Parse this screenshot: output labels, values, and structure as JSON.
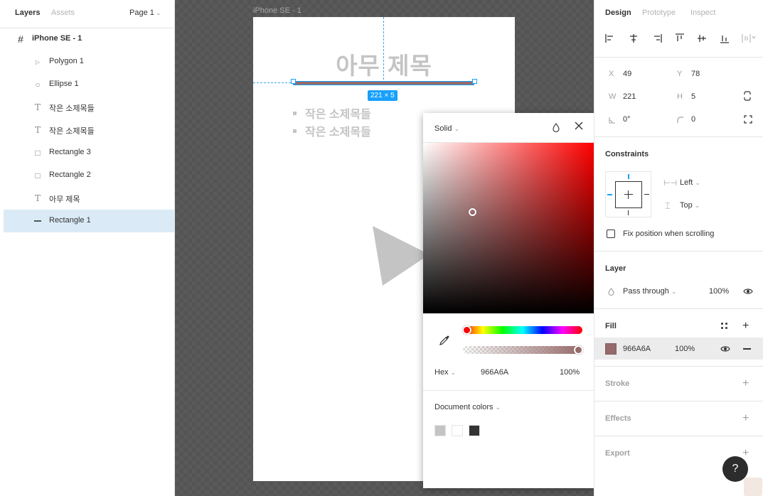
{
  "left_panel": {
    "tabs": [
      "Layers",
      "Assets"
    ],
    "page_selector": "Page 1",
    "layers": [
      {
        "name": "iPhone SE - 1",
        "icon": "frame-icon"
      },
      {
        "name": "Polygon 1",
        "icon": "polygon-icon"
      },
      {
        "name": "Ellipse 1",
        "icon": "ellipse-icon"
      },
      {
        "name": "작은 소제목들",
        "icon": "text-icon"
      },
      {
        "name": "작은 소제목들",
        "icon": "text-icon"
      },
      {
        "name": "Rectangle 3",
        "icon": "rectangle-icon"
      },
      {
        "name": "Rectangle 2",
        "icon": "rectangle-icon"
      },
      {
        "name": "아무 제목",
        "icon": "text-icon"
      },
      {
        "name": "Rectangle 1",
        "icon": "line-icon",
        "selected": true
      }
    ]
  },
  "canvas": {
    "frame_label": "iPhone SE - 1",
    "title_text": "아무 제목",
    "bullets": [
      "작은 소제목들",
      "작은 소제목들"
    ],
    "dimension_badge": "221 × 5",
    "selected_color": "#966a6a",
    "selection_color": "#18a0fb"
  },
  "color_picker": {
    "mode": "Solid",
    "format": "Hex",
    "hex": "966A6A",
    "opacity": "100%",
    "document_colors_label": "Document colors",
    "document_colors": [
      "#c4c4c4",
      "#ffffff",
      "#333333"
    ]
  },
  "right_panel": {
    "tabs": [
      "Design",
      "Prototype",
      "Inspect"
    ],
    "x_label": "X",
    "x": "49",
    "y_label": "Y",
    "y": "78",
    "w_label": "W",
    "w": "221",
    "h_label": "H",
    "h": "5",
    "rotation": "0°",
    "radius": "0",
    "constraints_title": "Constraints",
    "horizontal_constraint": "Left",
    "vertical_constraint": "Top",
    "fix_position_label": "Fix position when scrolling",
    "layer_title": "Layer",
    "blend_mode": "Pass through",
    "layer_opacity": "100%",
    "fill_title": "Fill",
    "fill_hex": "966A6A",
    "fill_opacity": "100%",
    "fill_color": "#966a6a",
    "stroke_title": "Stroke",
    "effects_title": "Effects",
    "export_title": "Export",
    "help": "?"
  }
}
